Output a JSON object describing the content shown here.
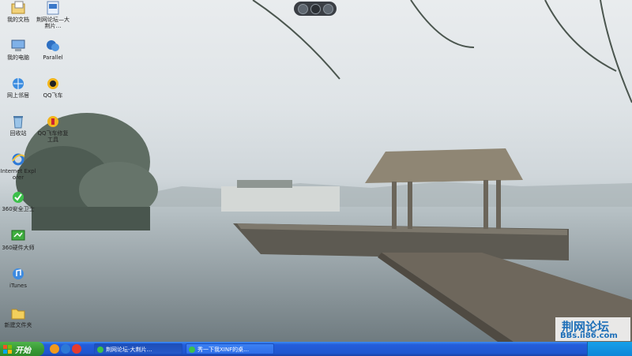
{
  "desktop": {
    "icons": [
      {
        "label": "我的文档",
        "icon": "my-documents-icon"
      },
      {
        "label": "荆网论坛—大荆片…",
        "icon": "shortcut-icon"
      },
      {
        "label": "我的电脑",
        "icon": "my-computer-icon"
      },
      {
        "label": "Parallel",
        "icon": "app-icon"
      },
      {
        "label": "网上邻居",
        "icon": "network-icon"
      },
      {
        "label": "QQ飞车",
        "icon": "qq-speed-icon"
      },
      {
        "label": "回收站",
        "icon": "recycle-bin-icon"
      },
      {
        "label": "QQ飞车修复工具",
        "icon": "qq-repair-icon"
      },
      {
        "label": "Internet Explorer",
        "icon": "internet-explorer-icon"
      },
      {
        "label": "360安全卫士",
        "icon": "360-safe-icon"
      },
      {
        "label": "360硬件大师",
        "icon": "360-hardware-icon"
      },
      {
        "label": "iTunes",
        "icon": "itunes-icon"
      },
      {
        "label": "新建文件夹",
        "icon": "folder-icon"
      }
    ]
  },
  "watermark": {
    "line1": "荆网论坛",
    "line2": "BBs.ii86.com"
  },
  "taskbar": {
    "start_label": "开始",
    "tasks": [
      {
        "label": "荆网论坛-大荆片…"
      },
      {
        "label": "秀一下我XINF的桌…"
      }
    ]
  }
}
